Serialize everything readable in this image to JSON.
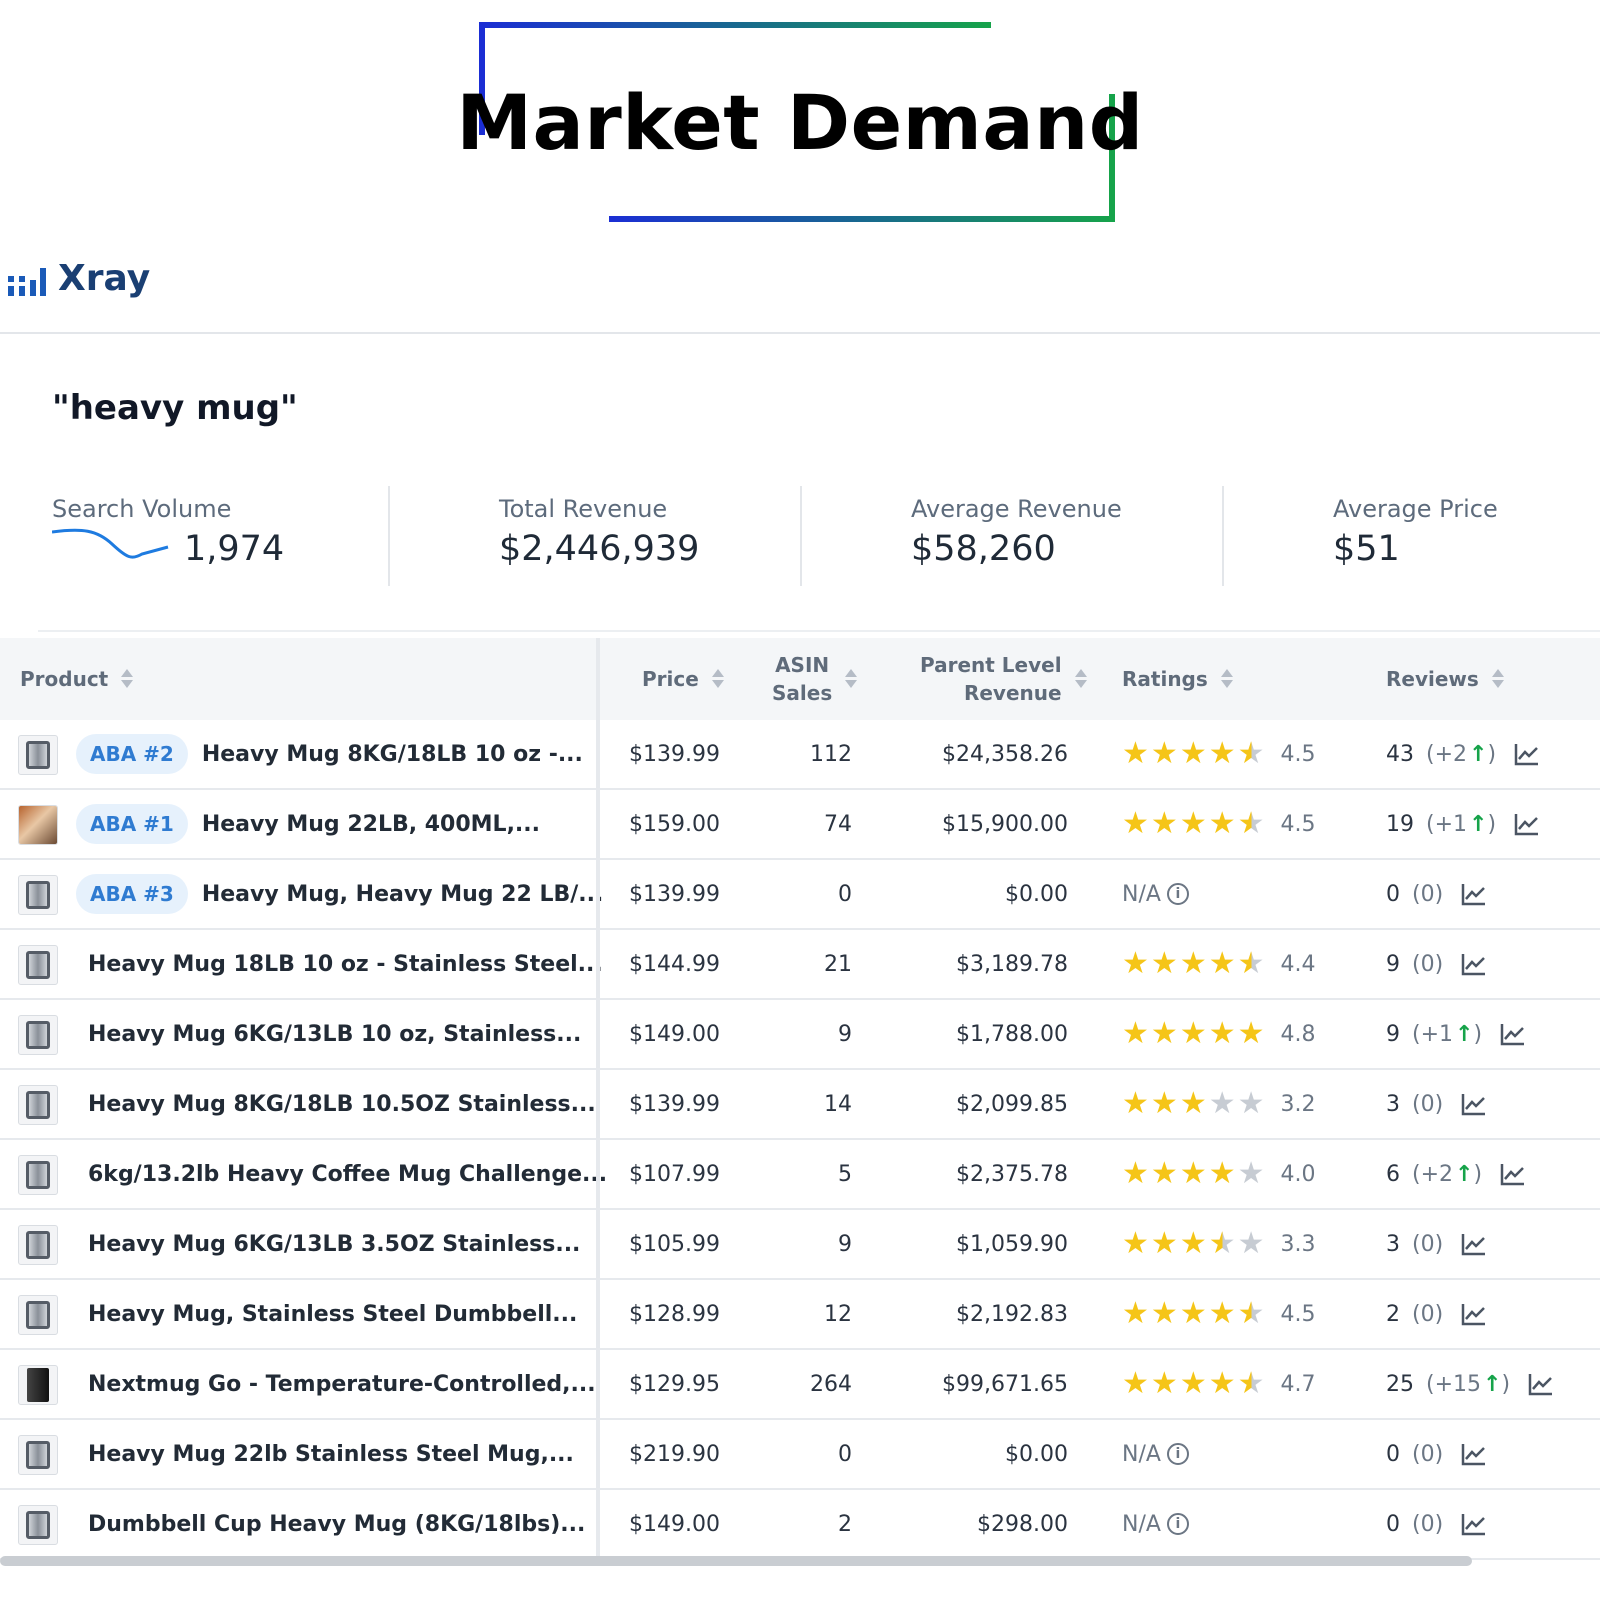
{
  "heading": "Market Demand",
  "app": {
    "name": "Xray",
    "logo_icon": "bar-chart-logo-icon"
  },
  "keyword": "\"heavy mug\"",
  "metrics": [
    {
      "label": "Search Volume",
      "value": "1,974"
    },
    {
      "label": "Total Revenue",
      "value": "$2,446,939"
    },
    {
      "label": "Average Revenue",
      "value": "$58,260"
    },
    {
      "label": "Average Price",
      "value": "$51"
    }
  ],
  "table": {
    "headers": {
      "product": "Product",
      "price": "Price",
      "asin_sales_1": "ASIN",
      "asin_sales_2": "Sales",
      "parent_revenue_1": "Parent Level",
      "parent_revenue_2": "Revenue",
      "ratings": "Ratings",
      "reviews": "Reviews"
    },
    "rows": [
      {
        "aba": "ABA #2",
        "title": "Heavy Mug 8KG/18LB 10 oz -...",
        "price": "$139.99",
        "sales": "112",
        "revenue": "$24,358.26",
        "rating": "4.5",
        "stars": 4.5,
        "reviews": "43",
        "delta": "(+2",
        "delta_up": true,
        "thumb": "mug"
      },
      {
        "aba": "ABA #1",
        "title": "Heavy Mug 22LB, 400ML,...",
        "price": "$159.00",
        "sales": "74",
        "revenue": "$15,900.00",
        "rating": "4.5",
        "stars": 4.5,
        "reviews": "19",
        "delta": "(+1",
        "delta_up": true,
        "thumb": "photo"
      },
      {
        "aba": "ABA #3",
        "title": "Heavy Mug, Heavy Mug 22 LB/...",
        "price": "$139.99",
        "sales": "0",
        "revenue": "$0.00",
        "rating": "N/A",
        "stars": null,
        "reviews": "0",
        "delta": "(0)",
        "delta_up": false,
        "thumb": "mug"
      },
      {
        "aba": "",
        "title": "Heavy Mug 18LB 10 oz - Stainless Steel...",
        "price": "$144.99",
        "sales": "21",
        "revenue": "$3,189.78",
        "rating": "4.4",
        "stars": 4.5,
        "reviews": "9",
        "delta": "(0)",
        "delta_up": false,
        "thumb": "mug"
      },
      {
        "aba": "",
        "title": "Heavy Mug 6KG/13LB 10 oz, Stainless...",
        "price": "$149.00",
        "sales": "9",
        "revenue": "$1,788.00",
        "rating": "4.8",
        "stars": 5,
        "reviews": "9",
        "delta": "(+1",
        "delta_up": true,
        "thumb": "mug"
      },
      {
        "aba": "",
        "title": "Heavy Mug 8KG/18LB 10.5OZ Stainless...",
        "price": "$139.99",
        "sales": "14",
        "revenue": "$2,099.85",
        "rating": "3.2",
        "stars": 3,
        "reviews": "3",
        "delta": "(0)",
        "delta_up": false,
        "thumb": "mug"
      },
      {
        "aba": "",
        "title": "6kg/13.2lb Heavy Coffee Mug Challenge...",
        "price": "$107.99",
        "sales": "5",
        "revenue": "$2,375.78",
        "rating": "4.0",
        "stars": 4,
        "reviews": "6",
        "delta": "(+2",
        "delta_up": true,
        "thumb": "mug"
      },
      {
        "aba": "",
        "title": "Heavy Mug 6KG/13LB 3.5OZ Stainless...",
        "price": "$105.99",
        "sales": "9",
        "revenue": "$1,059.90",
        "rating": "3.3",
        "stars": 3.5,
        "reviews": "3",
        "delta": "(0)",
        "delta_up": false,
        "thumb": "mug"
      },
      {
        "aba": "",
        "title": "Heavy Mug, Stainless Steel Dumbbell...",
        "price": "$128.99",
        "sales": "12",
        "revenue": "$2,192.83",
        "rating": "4.5",
        "stars": 4.5,
        "reviews": "2",
        "delta": "(0)",
        "delta_up": false,
        "thumb": "mug"
      },
      {
        "aba": "",
        "title": "Nextmug Go - Temperature-Controlled,...",
        "price": "$129.95",
        "sales": "264",
        "revenue": "$99,671.65",
        "rating": "4.7",
        "stars": 4.5,
        "reviews": "25",
        "delta": "(+15",
        "delta_up": true,
        "thumb": "dark"
      },
      {
        "aba": "",
        "title": "Heavy Mug 22lb Stainless Steel Mug,...",
        "price": "$219.90",
        "sales": "0",
        "revenue": "$0.00",
        "rating": "N/A",
        "stars": null,
        "reviews": "0",
        "delta": "(0)",
        "delta_up": false,
        "thumb": "mug"
      },
      {
        "aba": "",
        "title": "Dumbbell Cup Heavy Mug (8KG/18lbs)...",
        "price": "$149.00",
        "sales": "2",
        "revenue": "$298.00",
        "rating": "N/A",
        "stars": null,
        "reviews": "0",
        "delta": "(0)",
        "delta_up": false,
        "thumb": "mug"
      }
    ]
  },
  "colors": {
    "bracket_blue": "#1b2ed4",
    "bracket_green": "#16a34a",
    "star": "#f5c518",
    "aba_badge_bg": "#e6f1fc",
    "aba_badge_text": "#2f7bd1",
    "xray_brand": "#1a3f73",
    "sparkline": "#1e7be0"
  }
}
